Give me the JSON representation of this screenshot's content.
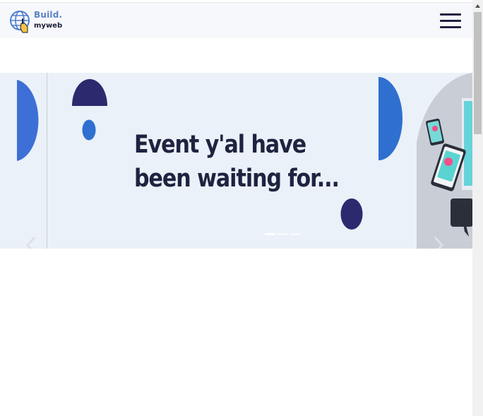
{
  "header": {
    "logo": {
      "line1": "Build.",
      "line2": "myweb",
      "icon": "globe-hand-icon"
    },
    "menu_icon": "hamburger-menu-icon"
  },
  "carousel": {
    "headline": {
      "line1": "Event y'al have",
      "line2": "been waiting for..."
    },
    "slide_count": 3,
    "active_slide": 1,
    "prev_icon": "chevron-left-icon",
    "next_icon": "chevron-right-icon"
  },
  "colors": {
    "header_bg": "#f7f8fb",
    "carousel_bg": "#eaf1f8",
    "headline": "#1f2340",
    "brand_blue": "#2f6fd0",
    "navy": "#2b2a6e"
  }
}
